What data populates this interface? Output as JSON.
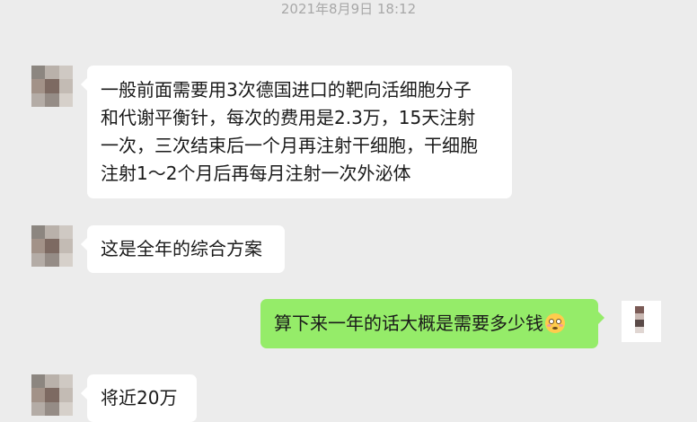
{
  "chat": {
    "timestamp": "2021年8月9日 18:12",
    "messages": [
      {
        "sender": "other",
        "lines": [
          "一般前面需要用3次德国进口的靶向活细胞分子",
          "和代谢平衡针，每次的费用是2.3万，15天注射",
          "一次，三次结束后一个月再注射干细胞，干细胞",
          "注射1～2个月后再每月注射一次外泌体"
        ]
      },
      {
        "sender": "other",
        "lines": [
          "这是全年的综合方案"
        ]
      },
      {
        "sender": "self",
        "lines": [
          "算下来一年的话大概是需要多少钱"
        ],
        "emoji": "flushed-face-icon"
      },
      {
        "sender": "other",
        "lines": [
          "将近20万"
        ]
      }
    ]
  },
  "colors": {
    "background": "#ececec",
    "bubble_other": "#ffffff",
    "bubble_self": "#95ec69",
    "timestamp_text": "#a8a8a8"
  },
  "avatars": {
    "other_mosaic": [
      "#8c8680",
      "#b9b1aa",
      "#cfc9c3",
      "#a29288",
      "#7d6a62",
      "#c3bbb4",
      "#b4aca6",
      "#958c86",
      "#d6d0ca"
    ],
    "self_mosaic": [
      "#7a5a55",
      "#c9b8b2",
      "#5a4a48",
      "#e0d6d2"
    ]
  }
}
